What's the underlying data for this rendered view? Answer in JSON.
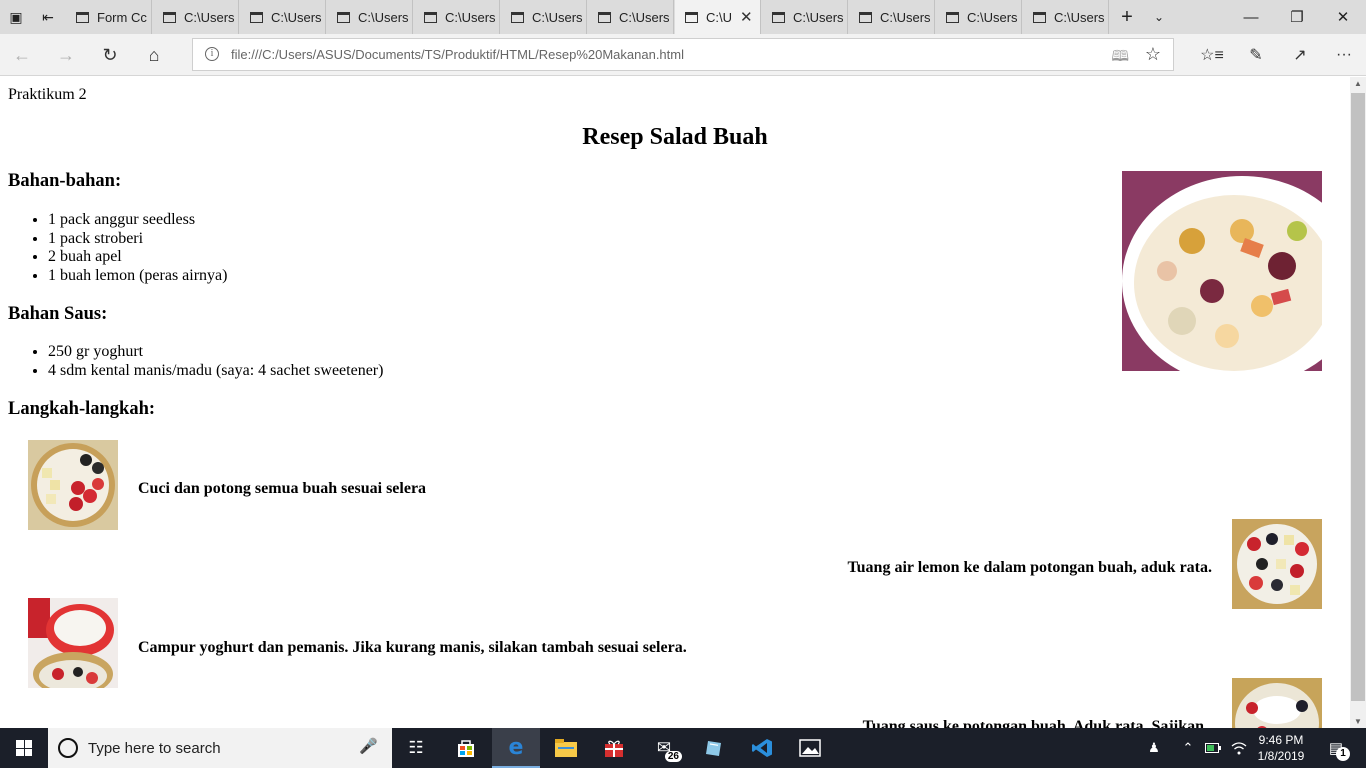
{
  "browser": {
    "tabs": [
      {
        "title": "Form Cc",
        "active": false,
        "closable": false
      },
      {
        "title": "C:\\Users",
        "active": false,
        "closable": false
      },
      {
        "title": "C:\\Users",
        "active": false,
        "closable": false
      },
      {
        "title": "C:\\Users",
        "active": false,
        "closable": false
      },
      {
        "title": "C:\\Users",
        "active": false,
        "closable": false
      },
      {
        "title": "C:\\Users",
        "active": false,
        "closable": false
      },
      {
        "title": "C:\\Users",
        "active": false,
        "closable": false
      },
      {
        "title": "C:\\U",
        "active": true,
        "closable": true
      },
      {
        "title": "C:\\Users",
        "active": false,
        "closable": false
      },
      {
        "title": "C:\\Users",
        "active": false,
        "closable": false
      },
      {
        "title": "C:\\Users",
        "active": false,
        "closable": false
      },
      {
        "title": "C:\\Users",
        "active": false,
        "closable": false
      }
    ],
    "address": "file:///C:/Users/ASUS/Documents/TS/Produktif/HTML/Resep%20Makanan.html"
  },
  "page": {
    "praktikum": "Praktikum 2",
    "title": "Resep Salad Buah",
    "bahan_heading": "Bahan-bahan:",
    "bahan_items": [
      "1 pack anggur seedless",
      "1 pack stroberi",
      "2 buah apel",
      "1 buah lemon (peras airnya)"
    ],
    "saus_heading": "Bahan Saus:",
    "saus_items": [
      "250 gr yoghurt",
      "4 sdm kental manis/madu (saya: 4 sachet sweetener)"
    ],
    "langkah_heading": "Langkah-langkah:",
    "steps": [
      "Cuci dan potong semua buah sesuai selera",
      "Tuang air lemon ke dalam potongan buah, aduk rata.",
      "Campur yoghurt dan pemanis. Jika kurang manis, silakan tambah sesuai selera.",
      "Tuang saus ke potongan buah. Aduk rata. Sajikan."
    ]
  },
  "taskbar": {
    "search_placeholder": "Type here to search",
    "mail_badge": "26",
    "time": "9:46 PM",
    "date": "1/8/2019",
    "notification_count": "1"
  },
  "icons": {
    "tab_actions": "tab-actions-icon",
    "set_aside": "set-aside-tabs-icon",
    "back": "back-arrow-icon",
    "forward": "forward-arrow-icon",
    "refresh": "refresh-icon",
    "home": "home-icon",
    "favorites": "favorites-icon",
    "notes": "pen-icon",
    "share": "share-icon",
    "more": "more-icon"
  },
  "colors": {
    "tab_strip": "#dcdcdc",
    "active_tab": "#f2f2f2",
    "taskbar": "#1b1f29",
    "edge_blue": "#2a84d6"
  }
}
